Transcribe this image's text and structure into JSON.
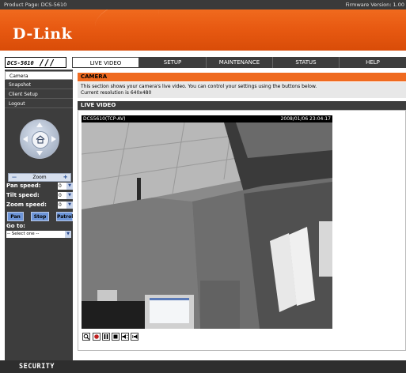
{
  "topbar": {
    "product": "Product Page: DCS-5610",
    "firmware": "Firmware Version: 1.00"
  },
  "brand": {
    "logo_text": "D-Link"
  },
  "model_label": "DCS-5610",
  "nav": {
    "tabs": [
      {
        "label": "LIVE VIDEO",
        "active": true
      },
      {
        "label": "SETUP"
      },
      {
        "label": "MAINTENANCE"
      },
      {
        "label": "STATUS"
      },
      {
        "label": "HELP"
      }
    ]
  },
  "sidebar": {
    "items": [
      {
        "label": "Camera",
        "active": true
      },
      {
        "label": "Snapshot"
      },
      {
        "label": "Client Setup"
      },
      {
        "label": "Logout"
      }
    ],
    "zoom_label": "Zoom",
    "pan_speed_label": "Pan speed:",
    "tilt_speed_label": "Tilt speed:",
    "zoom_speed_label": "Zoom speed:",
    "pan_speed_value": "0",
    "tilt_speed_value": "0",
    "zoom_speed_value": "0",
    "pan_button": "Pan",
    "stop_button": "Stop",
    "patrol_button": "Patrol",
    "goto_label": "Go to:",
    "goto_value": "-- Select one --"
  },
  "camera": {
    "heading": "CAMERA",
    "description": "This section shows your camera's live video. You can control your settings using the buttons below.",
    "resolution": "Current resolution is 640x480"
  },
  "live_video": {
    "heading": "LIVE VIDEO",
    "stream_label": "DCS5610(TCP-AV)",
    "timestamp": "2008/01/06 23:04:17"
  },
  "footer": {
    "label": "SECURITY"
  },
  "colors": {
    "brand_orange": "#ef6a20",
    "dark_gray": "#3d3d3d",
    "button_blue": "#6d95d8"
  }
}
